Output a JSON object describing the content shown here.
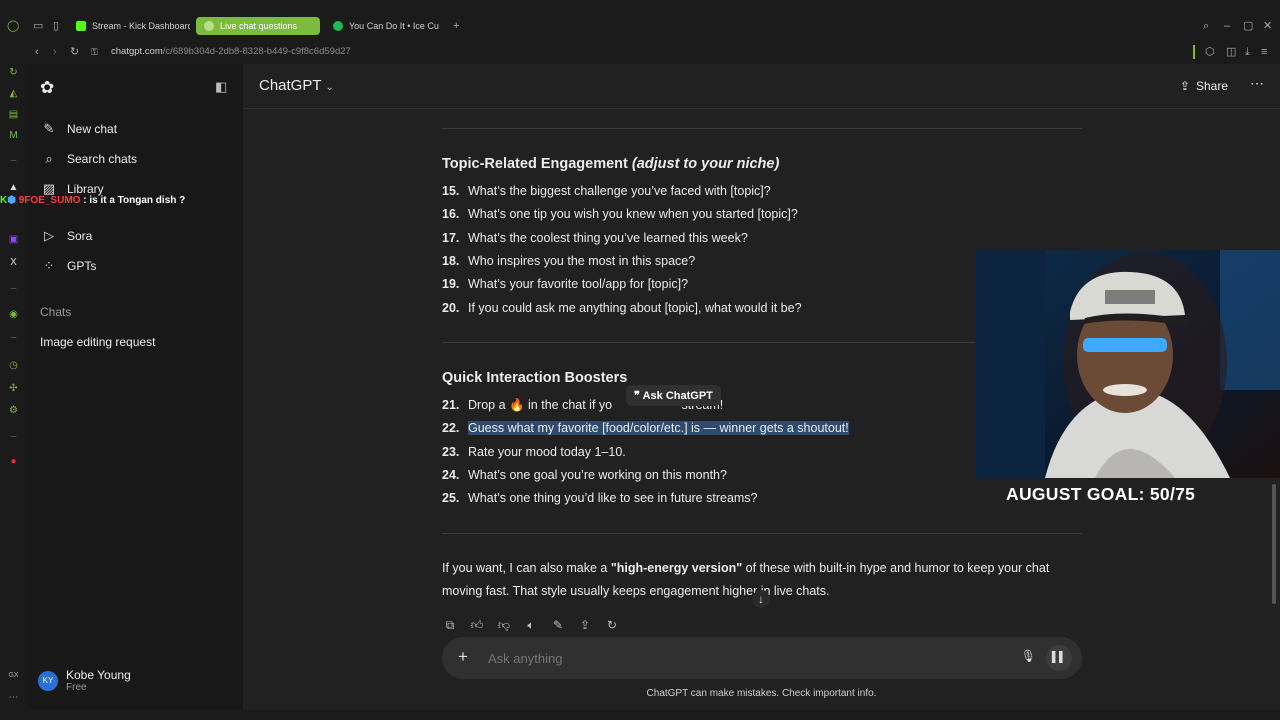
{
  "browser": {
    "tabs": [
      {
        "label": "Stream - Kick Dashboard"
      },
      {
        "label": "Live chat questions"
      },
      {
        "label": "You Can Do It • Ice Cu"
      }
    ],
    "url_host": "chatgpt.com",
    "url_path": "/c/689b304d-2db8-8328-b449-c9f8c6d59d27"
  },
  "sidebar": {
    "items": [
      {
        "label": "New chat",
        "icon": "edit-icon"
      },
      {
        "label": "Search chats",
        "icon": "search-icon"
      },
      {
        "label": "Library",
        "icon": "library-icon"
      },
      {
        "label": "Sora",
        "icon": "play-icon"
      },
      {
        "label": "GPTs",
        "icon": "grid-icon"
      }
    ],
    "chats_label": "Chats",
    "chats": [
      "Image editing request"
    ],
    "user": {
      "initials": "KY",
      "name": "Kobe Young",
      "plan": "Free"
    }
  },
  "stream_chat": {
    "user": "9FOE_SUMO",
    "message": ": is it a Tongan dish ?"
  },
  "header": {
    "model": "ChatGPT",
    "share": "Share"
  },
  "content": {
    "section1_title": "Topic-Related Engagement",
    "section1_note": "(adjust to your niche)",
    "section1_items": [
      {
        "n": "15.",
        "text": "What’s the biggest challenge you’ve faced with [topic]?"
      },
      {
        "n": "16.",
        "text": "What’s one tip you wish you knew when you started [topic]?"
      },
      {
        "n": "17.",
        "text": "What’s the coolest thing you’ve learned this week?"
      },
      {
        "n": "18.",
        "text": "Who inspires you the most in this space?"
      },
      {
        "n": "19.",
        "text": "What’s your favorite tool/app for [topic]?"
      },
      {
        "n": "20.",
        "text": "If you could ask me anything about [topic], what would it be?"
      }
    ],
    "section2_title": "Quick Interaction Boosters",
    "section2_items": [
      {
        "n": "21.",
        "text": "Drop a 🔥 in the chat if yo                    stream!"
      },
      {
        "n": "22.",
        "text": "Guess what my favorite [food/color/etc.] is — winner gets a shoutout!"
      },
      {
        "n": "23.",
        "text": "Rate your mood today 1–10."
      },
      {
        "n": "24.",
        "text": "What’s one goal you’re working on this month?"
      },
      {
        "n": "25.",
        "text": "What’s one thing you’d like to see in future streams?"
      }
    ],
    "ask_bubble": "Ask ChatGPT",
    "para_pre": "If you want, I can also make a ",
    "para_bold": "\"high-energy version\"",
    "para_post": " of these with built-in hype and humor to keep your chat moving fast. That style usually keeps engagement higher in live chats."
  },
  "composer": {
    "placeholder": "Ask anything"
  },
  "disclaimer": "ChatGPT can make mistakes. Check important info.",
  "overlay": {
    "goal_text": "AUGUST GOAL: 50/75"
  },
  "colors": {
    "accent_green": "#7dbb3f",
    "highlight": "#2e4a6d",
    "bg": "#212121",
    "sidebar": "#181818"
  }
}
